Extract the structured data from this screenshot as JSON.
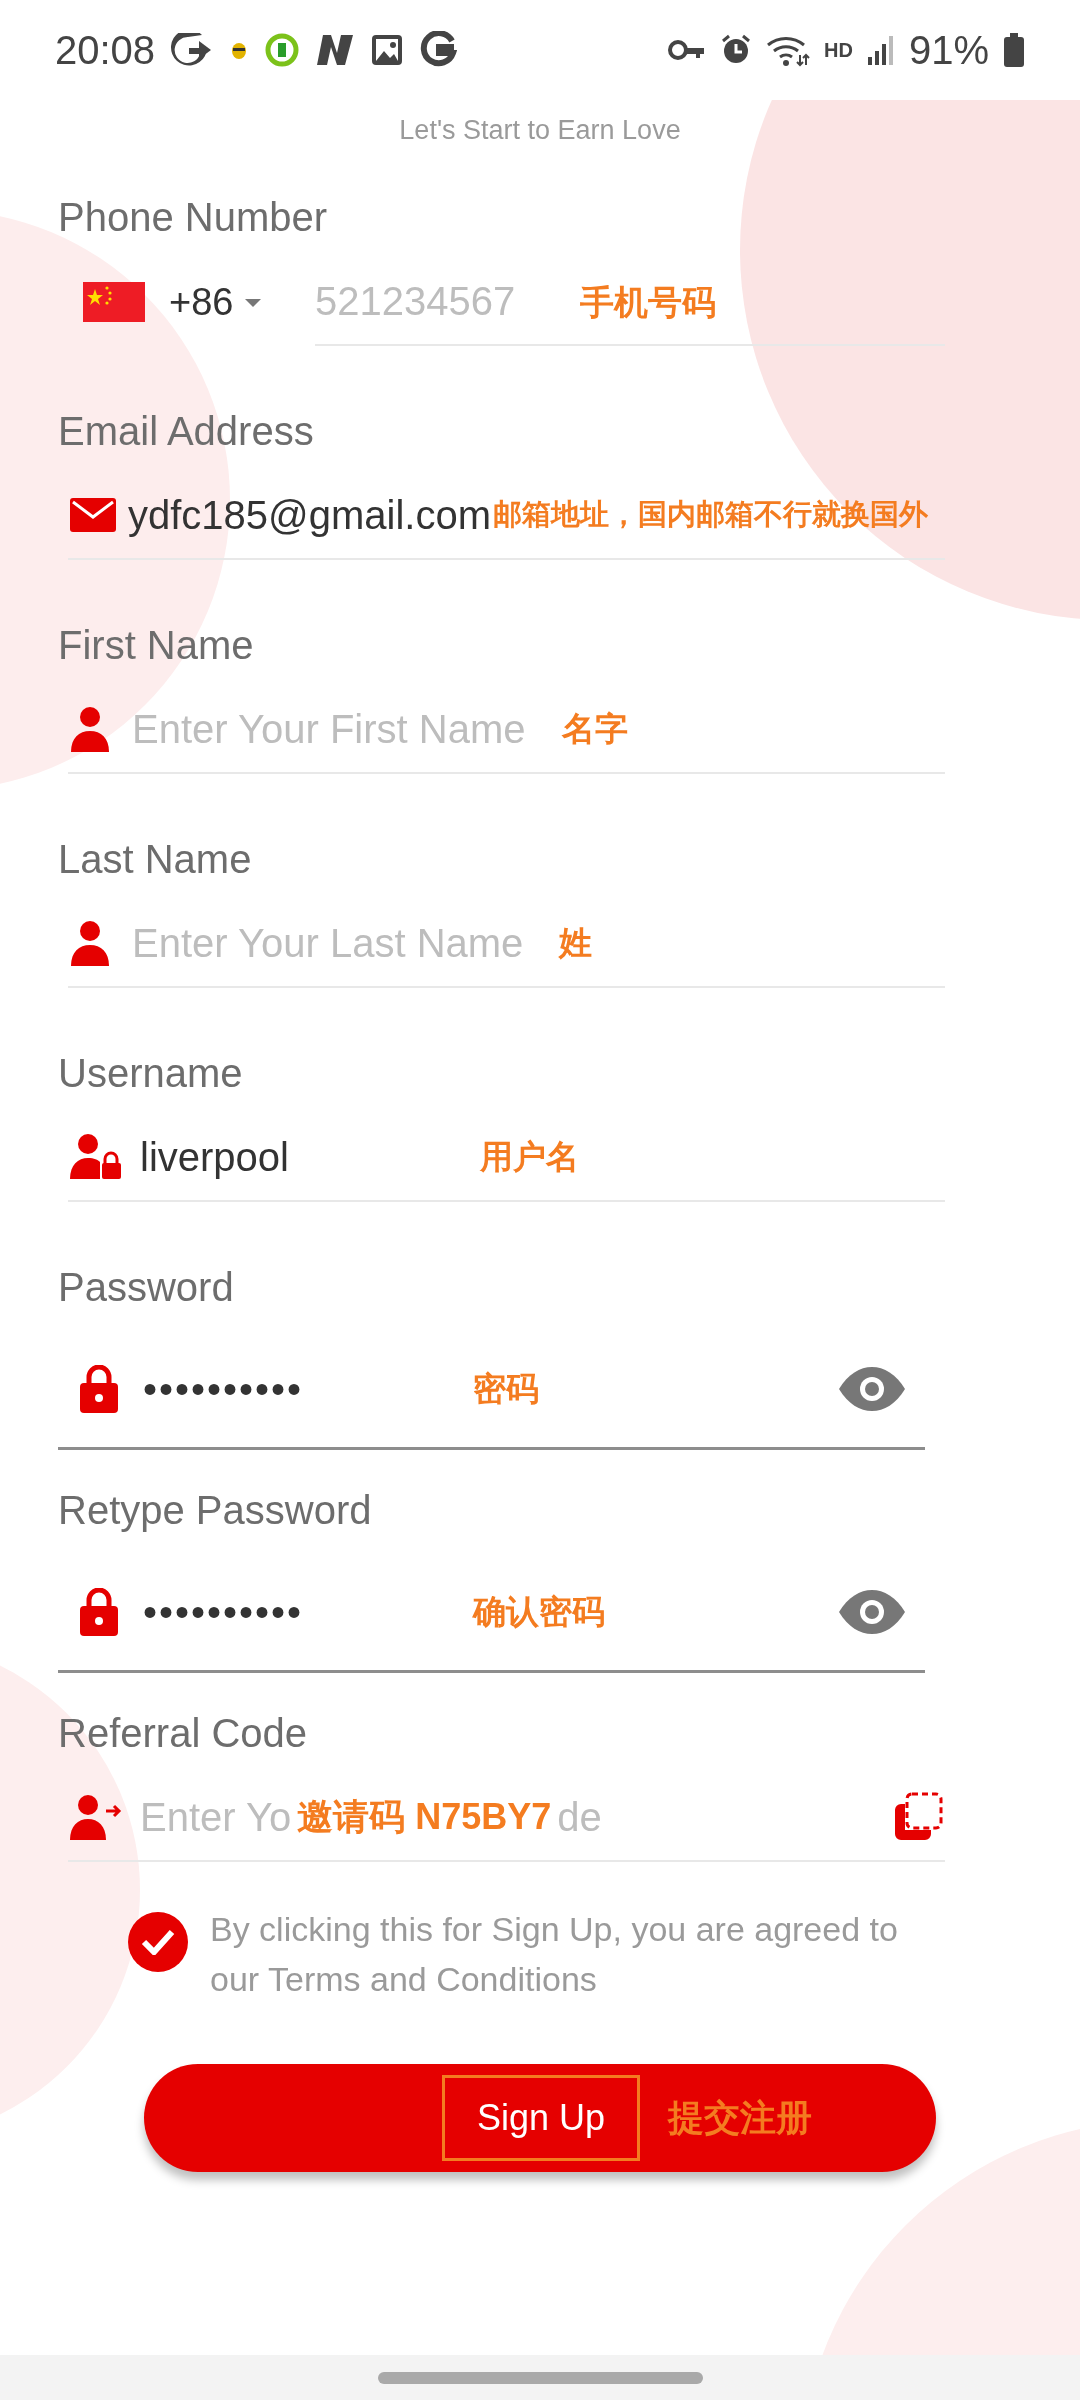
{
  "status_bar": {
    "time": "20:08",
    "network": "HD",
    "battery": "91%"
  },
  "subtitle": "Let's Start to Earn Love",
  "fields": [
    {
      "kind": "phone",
      "label": "Phone Number",
      "country_code": "+86",
      "placeholder": "521234567",
      "note": "手机号码"
    },
    {
      "kind": "email",
      "label": "Email Address",
      "value": "ydfc185@gmail.com",
      "note": "邮箱地址，国内邮箱不行就换国外"
    },
    {
      "kind": "name",
      "label": "First Name",
      "placeholder": "Enter Your First Name",
      "note": "名字"
    },
    {
      "kind": "name",
      "label": "Last Name",
      "placeholder": "Enter Your Last Name",
      "note": "姓"
    },
    {
      "kind": "username",
      "label": "Username",
      "value": "liverpool",
      "note": "用户名"
    },
    {
      "kind": "password",
      "label": "Password",
      "value": "••••••••••",
      "note": "密码"
    },
    {
      "kind": "password",
      "label": "Retype Password",
      "value": "••••••••••",
      "note": "确认密码"
    },
    {
      "kind": "referral",
      "label": "Referral Code",
      "placeholder_parts": [
        "Enter Yo",
        "de"
      ],
      "note": "邀请码  N75BY7"
    }
  ],
  "terms": {
    "checked": true,
    "text": "By clicking this for Sign Up, you are agreed to our Terms and Conditions"
  },
  "submit": {
    "label": "Sign Up",
    "note": "提交注册"
  }
}
